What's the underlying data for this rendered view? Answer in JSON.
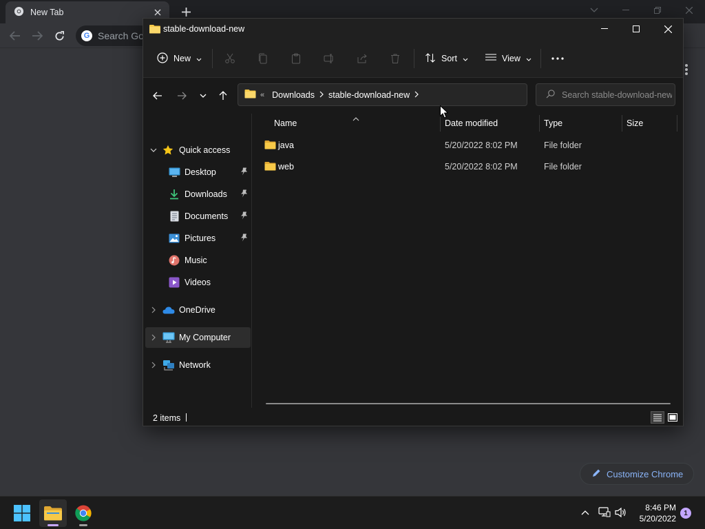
{
  "chrome": {
    "tab_title": "New Tab",
    "omnibox_placeholder": "Search Goo",
    "customize_label": "Customize Chrome"
  },
  "explorer": {
    "window_title": "stable-download-new",
    "commandbar": {
      "new_label": "New",
      "sort_label": "Sort",
      "view_label": "View"
    },
    "address": {
      "overflow_glyph": "«",
      "segments": [
        "Downloads",
        "stable-download-new"
      ]
    },
    "search_placeholder": "Search stable-download-new",
    "nav": {
      "quick_access": "Quick access",
      "desktop": "Desktop",
      "downloads": "Downloads",
      "documents": "Documents",
      "pictures": "Pictures",
      "music": "Music",
      "videos": "Videos",
      "onedrive": "OneDrive",
      "my_computer": "My Computer",
      "network": "Network"
    },
    "columns": {
      "name": "Name",
      "date_modified": "Date modified",
      "type": "Type",
      "size": "Size"
    },
    "files": [
      {
        "name": "java",
        "date_modified": "5/20/2022 8:02 PM",
        "type": "File folder",
        "size": ""
      },
      {
        "name": "web",
        "date_modified": "5/20/2022 8:02 PM",
        "type": "File folder",
        "size": ""
      }
    ],
    "status": {
      "item_count": "2 items"
    }
  },
  "taskbar": {
    "time": "8:46 PM",
    "date": "5/20/2022",
    "notification_count": "1"
  },
  "icons": {
    "window_folder": "folder-icon",
    "chrome_app": "chrome-icon",
    "start": "windows-start-icon"
  },
  "colors": {
    "folder_yellow": "#f7c948",
    "accent": "#8ab4f8",
    "explorer_bg": "#191919",
    "chrome_bg": "#35363a"
  }
}
